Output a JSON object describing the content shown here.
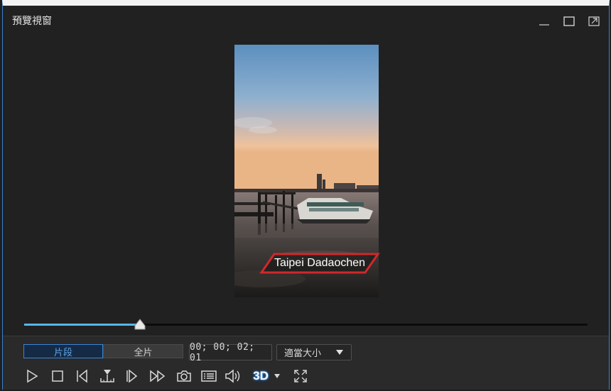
{
  "window": {
    "title": "預覽視窗",
    "border_color": "#3a7fd0"
  },
  "window_controls": {
    "minimize_icon": "minimize-icon",
    "maximize_icon": "maximize-icon",
    "undock_icon": "undock-icon"
  },
  "preview": {
    "caption": "Taipei Dadaochen",
    "caption_frame_color": "#d0282b"
  },
  "playback": {
    "progress_fraction": 0.205,
    "progress_color": "#56b7e8"
  },
  "mode_tabs": {
    "clip_label": "片段",
    "movie_label": "全片",
    "active": "clip"
  },
  "timecode": "00; 00; 02; 01",
  "fit_select": {
    "value": "適當大小"
  },
  "toolbar": {
    "three_d_label": "3D",
    "icons": [
      "play-icon",
      "stop-icon",
      "previous-frame-icon",
      "split-icon",
      "next-frame-icon",
      "fast-forward-icon",
      "snapshot-icon",
      "subtitle-icon",
      "volume-icon",
      "3d-icon",
      "dropdown-icon",
      "fullscreen-icon"
    ]
  }
}
